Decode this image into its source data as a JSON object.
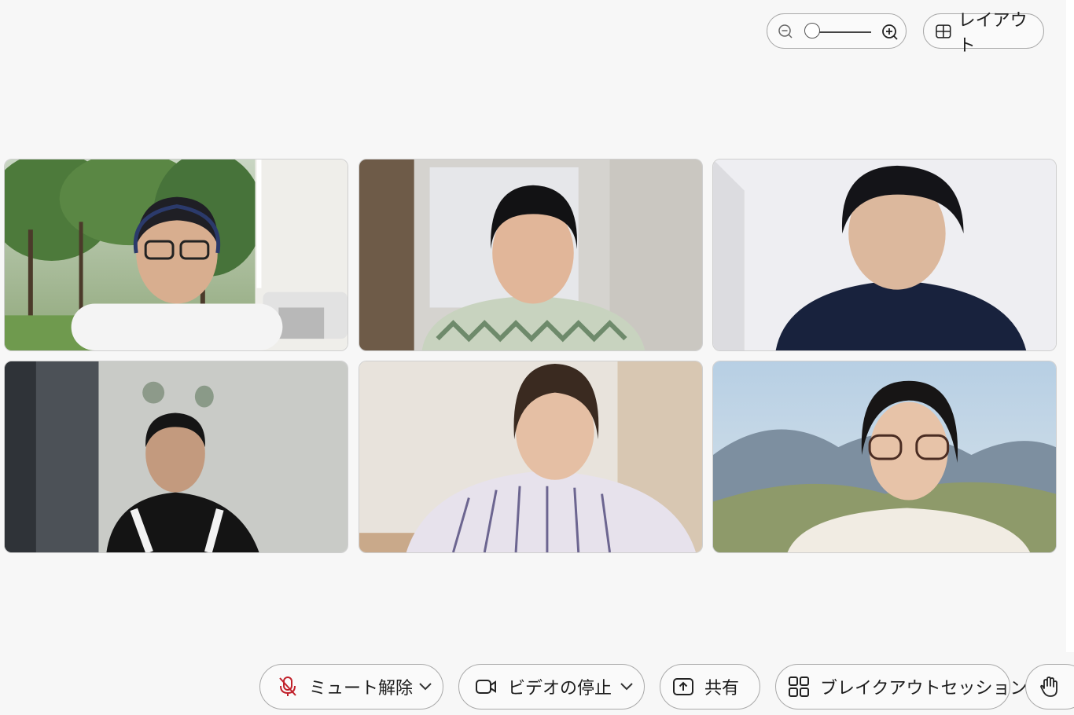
{
  "top_controls": {
    "zoom_out_icon": "zoom-out-icon",
    "zoom_in_icon": "zoom-in-icon",
    "zoom_level": 0,
    "layout_label": "レイアウト"
  },
  "participants": [
    {
      "id": 1,
      "background": "forest-virtual-background"
    },
    {
      "id": 2,
      "background": "blurred-room"
    },
    {
      "id": 3,
      "background": "white-wall"
    },
    {
      "id": 4,
      "background": "grey-wall"
    },
    {
      "id": 5,
      "background": "blurred-room"
    },
    {
      "id": 6,
      "background": "mountain-virtual-background"
    }
  ],
  "toolbar": {
    "mute_label": "ミュート解除",
    "video_label": "ビデオの停止",
    "share_label": "共有",
    "breakout_label": "ブレイクアウトセッション",
    "mute_icon": "mic-off-icon",
    "video_icon": "camera-icon",
    "share_icon": "share-screen-icon",
    "breakout_icon": "breakout-grid-icon",
    "raise_icon": "raise-hand-icon"
  },
  "colors": {
    "background": "#f7f7f7",
    "mute_icon": "#c0202a",
    "border": "#a9a9a9"
  }
}
